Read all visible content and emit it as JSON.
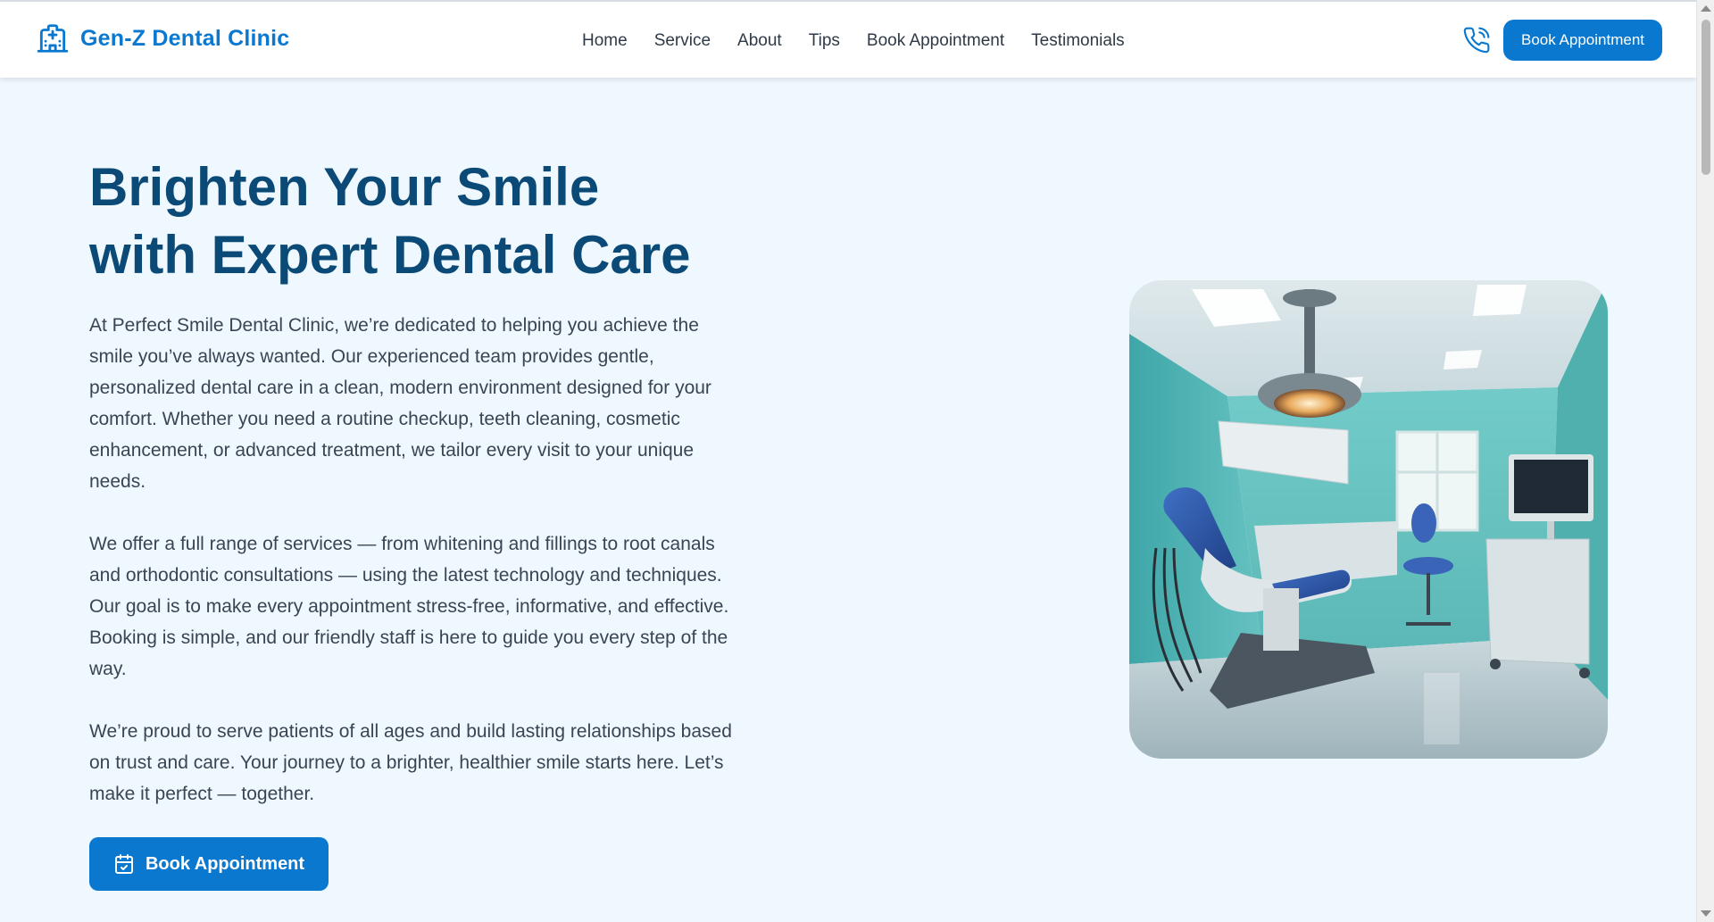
{
  "header": {
    "brand_name": "Gen-Z Dental Clinic",
    "nav": [
      "Home",
      "Service",
      "About",
      "Tips",
      "Book Appointment",
      "Testimonials"
    ],
    "cta_label": "Book Appointment",
    "icons": {
      "brand": "hospital-icon",
      "phone": "phone-icon"
    }
  },
  "hero": {
    "title_line1": "Brighten Your Smile",
    "title_line2": "with Expert Dental Care",
    "paragraphs": [
      "At Perfect Smile Dental Clinic, we’re dedicated to helping you achieve the smile you’ve always wanted. Our experienced team provides gentle, personalized dental care in a clean, modern environment designed for your comfort. Whether you need a routine checkup, teeth cleaning, cosmetic enhancement, or advanced treatment, we tailor every visit to your unique needs.",
      "We offer a full range of services — from whitening and fillings to root canals and orthodontic consultations — using the latest technology and techniques. Our goal is to make every appointment stress-free, informative, and effective. Booking is simple, and our friendly staff is here to guide you every step of the way.",
      "We’re proud to serve patients of all ages and build lasting relationships based on trust and care. Your journey to a brighter, healthier smile starts here. Let’s make it perfect — together."
    ],
    "cta_label": "Book Appointment",
    "cta_icon": "calendar-check-icon"
  },
  "colors": {
    "accent": "#0b78d0",
    "title": "#0b4a76",
    "background": "#f0f8ff",
    "body_text": "#3a4452"
  }
}
